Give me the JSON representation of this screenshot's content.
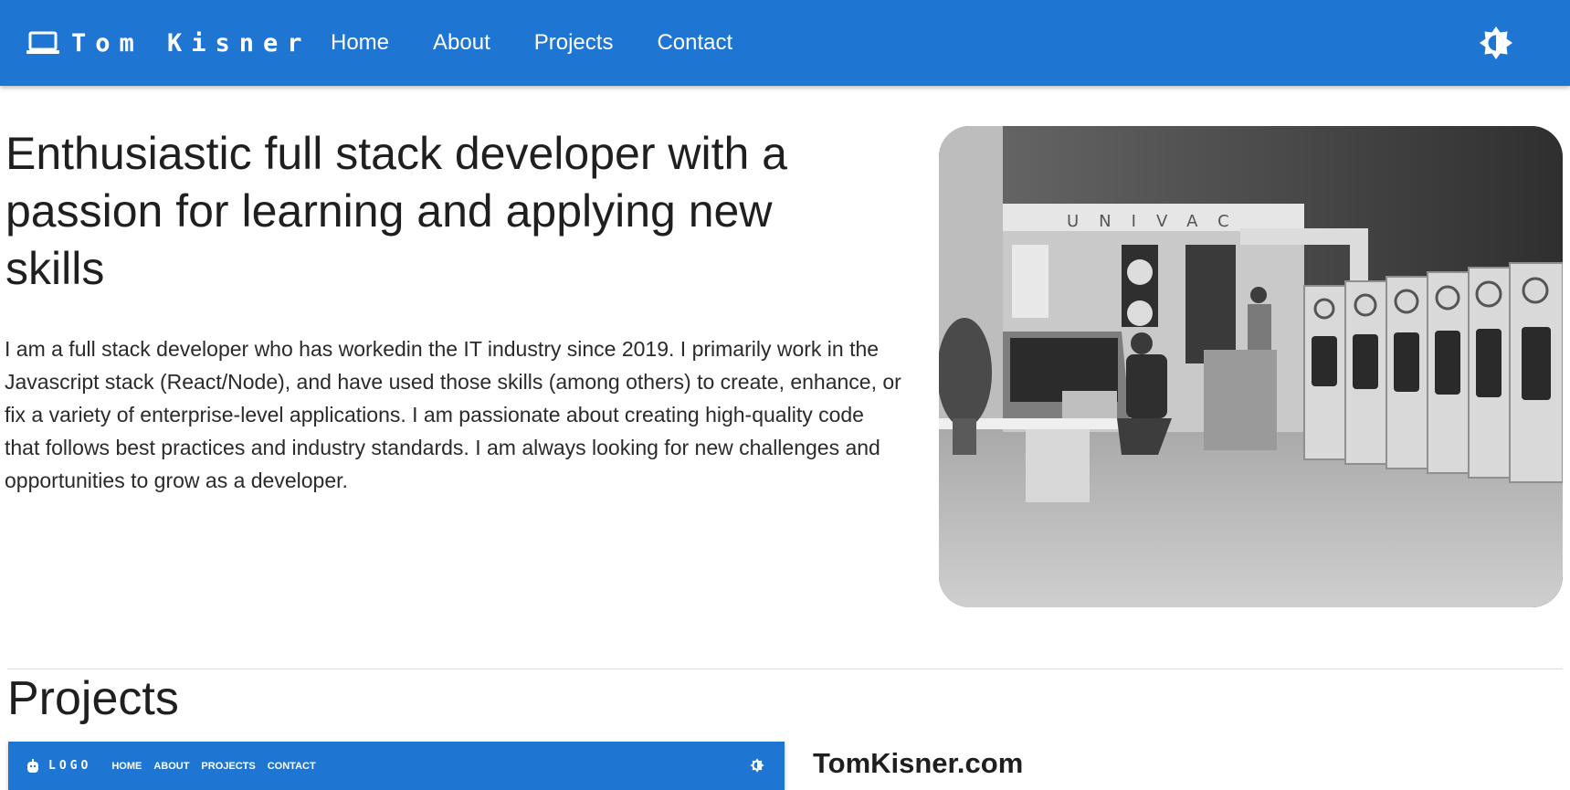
{
  "header": {
    "brand": "Tom Kisner",
    "brand_icon": "laptop-icon",
    "nav": [
      "Home",
      "About",
      "Projects",
      "Contact"
    ],
    "theme_toggle_icon": "brightness-icon",
    "color": "#1e76d2"
  },
  "hero": {
    "title": "Enthusiastic full stack developer with a passion for learning and applying new skills",
    "body": "I am a full stack developer who has workedin the IT industry since 2019. I primarily work in the Javascript stack (React/Node), and have used those skills (among others) to create, enhance, or fix a variety of enterprise-level applications. I am passionate about creating high-quality code that follows best practices and industry standards. I am always looking for new challenges and opportunities to grow as a developer.",
    "photo_text": "UNIVAC"
  },
  "projects": {
    "heading": "Projects",
    "items": [
      {
        "title": "TomKisner.com",
        "thumbnail": {
          "logo": "LOGO",
          "logo_icon": "robot-icon",
          "nav": [
            "HOME",
            "ABOUT",
            "PROJECTS",
            "CONTACT"
          ],
          "toggle_icon": "brightness-icon"
        }
      }
    ]
  }
}
